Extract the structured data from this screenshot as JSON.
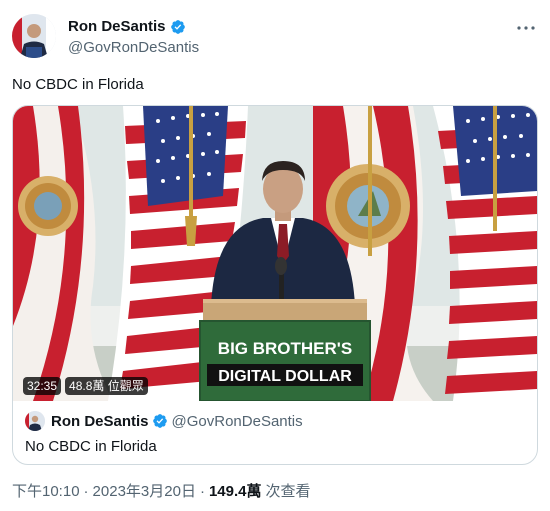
{
  "author": {
    "display_name": "Ron DeSantis",
    "handle": "@GovRonDeSantis"
  },
  "tweet": {
    "text": "No CBDC in Florida"
  },
  "quoted_tweet": {
    "display_name": "Ron DeSantis",
    "handle": "@GovRonDeSantis",
    "text": "No CBDC in Florida",
    "media": {
      "duration": "32:35",
      "view_count": "48.8萬 位觀眾",
      "podium_sign_line1": "BIG BROTHER'S",
      "podium_sign_line2": "DIGITAL DOLLAR",
      "seal_text": "GREAT SEAL OF THE STATE OF FLORIDA"
    }
  },
  "meta": {
    "time": "下午10:10",
    "date": "2023年3月20日",
    "separator": "·",
    "views_count": "149.4萬",
    "views_label": "次查看"
  },
  "colors": {
    "verified": "#1d9bf0",
    "sign_green": "#2f6b3a",
    "secondary_text": "#536471"
  }
}
